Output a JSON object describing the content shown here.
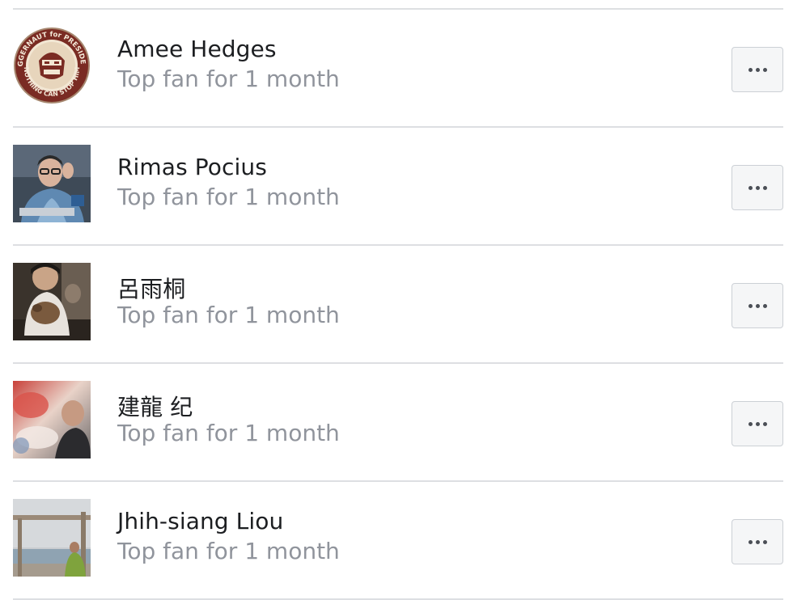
{
  "fans": [
    {
      "name": "Amee Hedges",
      "subtitle": "Top fan for 1 month",
      "avatar": "juggernaut-for-president-badge"
    },
    {
      "name": "Rimas Pocius",
      "subtitle": "Top fan for 1 month",
      "avatar": "man-with-glasses-photo"
    },
    {
      "name": "呂雨桐",
      "subtitle": "Top fan for 1 month",
      "avatar": "person-with-cat-photo"
    },
    {
      "name": "建龍 纪",
      "subtitle": "Top fan for 1 month",
      "avatar": "blurred-photo"
    },
    {
      "name": "Jhih-siang Liou",
      "subtitle": "Top fan for 1 month",
      "avatar": "person-at-seaside-photo"
    }
  ],
  "more_button_icon": "more-options-icon",
  "badge_text": {
    "top": "JUGGERNAUT for PRESIDENT",
    "bottom": "NOTHING CAN STOP HIM"
  }
}
